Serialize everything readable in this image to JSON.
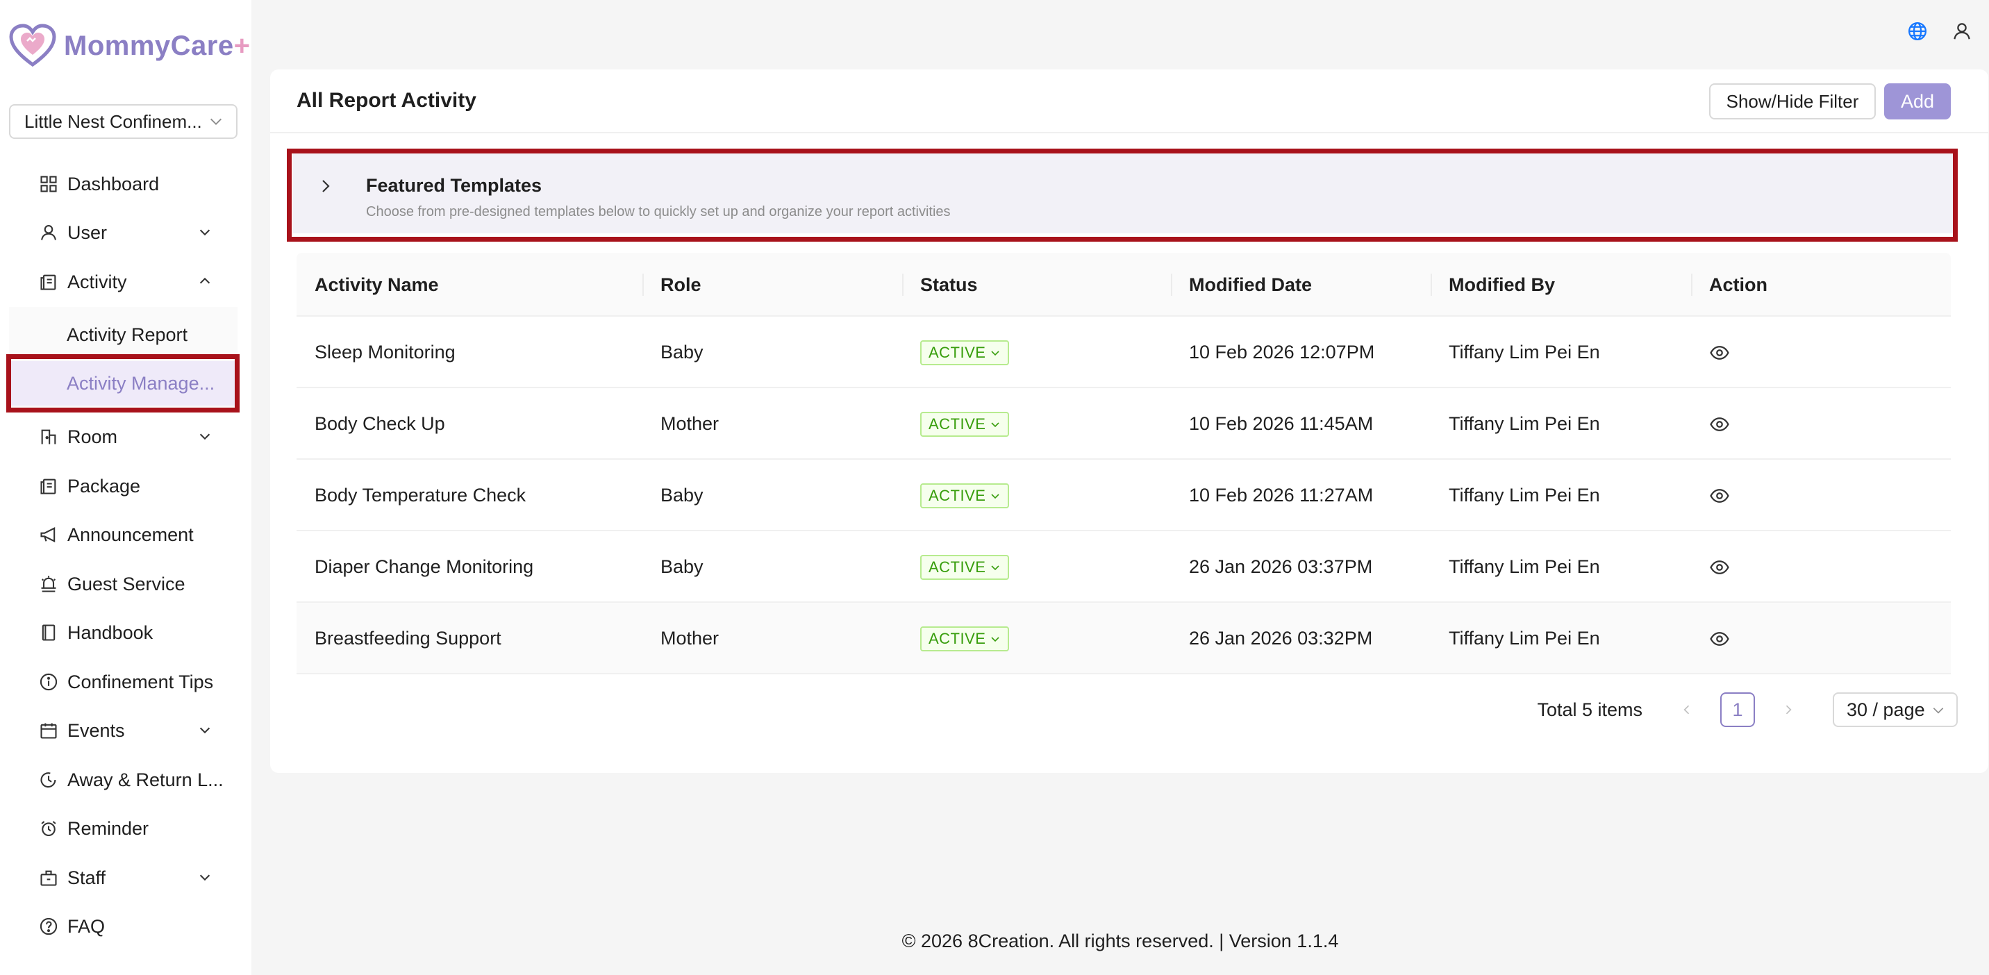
{
  "app": {
    "name": "MommyCare",
    "name_suffix": "+"
  },
  "org_select": {
    "value": "Little Nest Confinem..."
  },
  "sidebar": {
    "items": [
      {
        "label": "Dashboard",
        "icon": "dashboard-icon"
      },
      {
        "label": "User",
        "icon": "user-icon",
        "expandable": true
      },
      {
        "label": "Activity",
        "icon": "activity-icon",
        "expandable": true,
        "expanded": true
      },
      {
        "label": "Room",
        "icon": "room-icon",
        "expandable": true
      },
      {
        "label": "Package",
        "icon": "package-icon"
      },
      {
        "label": "Announcement",
        "icon": "megaphone-icon"
      },
      {
        "label": "Guest Service",
        "icon": "bell-icon"
      },
      {
        "label": "Handbook",
        "icon": "book-icon"
      },
      {
        "label": "Confinement Tips",
        "icon": "info-icon"
      },
      {
        "label": "Events",
        "icon": "calendar-icon",
        "expandable": true
      },
      {
        "label": "Away & Return L...",
        "icon": "clock-history-icon"
      },
      {
        "label": "Reminder",
        "icon": "alarm-icon"
      },
      {
        "label": "Staff",
        "icon": "briefcase-icon",
        "expandable": true
      },
      {
        "label": "FAQ",
        "icon": "question-icon"
      }
    ],
    "activity_sub": [
      {
        "label": "Activity Report"
      },
      {
        "label": "Activity Manage...",
        "selected": true
      }
    ]
  },
  "header": {
    "icons": [
      "globe-icon",
      "user-icon"
    ]
  },
  "page": {
    "title": "All Report Activity",
    "filter_button": "Show/Hide Filter",
    "add_button": "Add"
  },
  "templates": {
    "title": "Featured Templates",
    "subtitle": "Choose from pre-designed templates below to quickly set up and organize your report activities"
  },
  "table": {
    "columns": [
      "Activity Name",
      "Role",
      "Status",
      "Modified Date",
      "Modified By",
      "Action"
    ],
    "rows": [
      {
        "name": "Sleep Monitoring",
        "role": "Baby",
        "status": "ACTIVE",
        "date": "10 Feb 2026 12:07PM",
        "by": "Tiffany Lim Pei En"
      },
      {
        "name": "Body Check Up",
        "role": "Mother",
        "status": "ACTIVE",
        "date": "10 Feb 2026 11:45AM",
        "by": "Tiffany Lim Pei En"
      },
      {
        "name": "Body Temperature Check",
        "role": "Baby",
        "status": "ACTIVE",
        "date": "10 Feb 2026 11:27AM",
        "by": "Tiffany Lim Pei En"
      },
      {
        "name": "Diaper Change Monitoring",
        "role": "Baby",
        "status": "ACTIVE",
        "date": "26 Jan 2026 03:37PM",
        "by": "Tiffany Lim Pei En"
      },
      {
        "name": "Breastfeeding Support",
        "role": "Mother",
        "status": "ACTIVE",
        "date": "26 Jan 2026 03:32PM",
        "by": "Tiffany Lim Pei En"
      }
    ]
  },
  "pagination": {
    "total": "Total 5 items",
    "current_page": "1",
    "page_size": "30 / page"
  },
  "footer": {
    "text": "© 2026 8Creation. All rights reserved. | Version 1.1.4"
  },
  "colors": {
    "brand": "#8b7fc4",
    "brand_pink": "#e79bc1",
    "highlight": "#a8121b",
    "active_green": "#389e0d"
  }
}
